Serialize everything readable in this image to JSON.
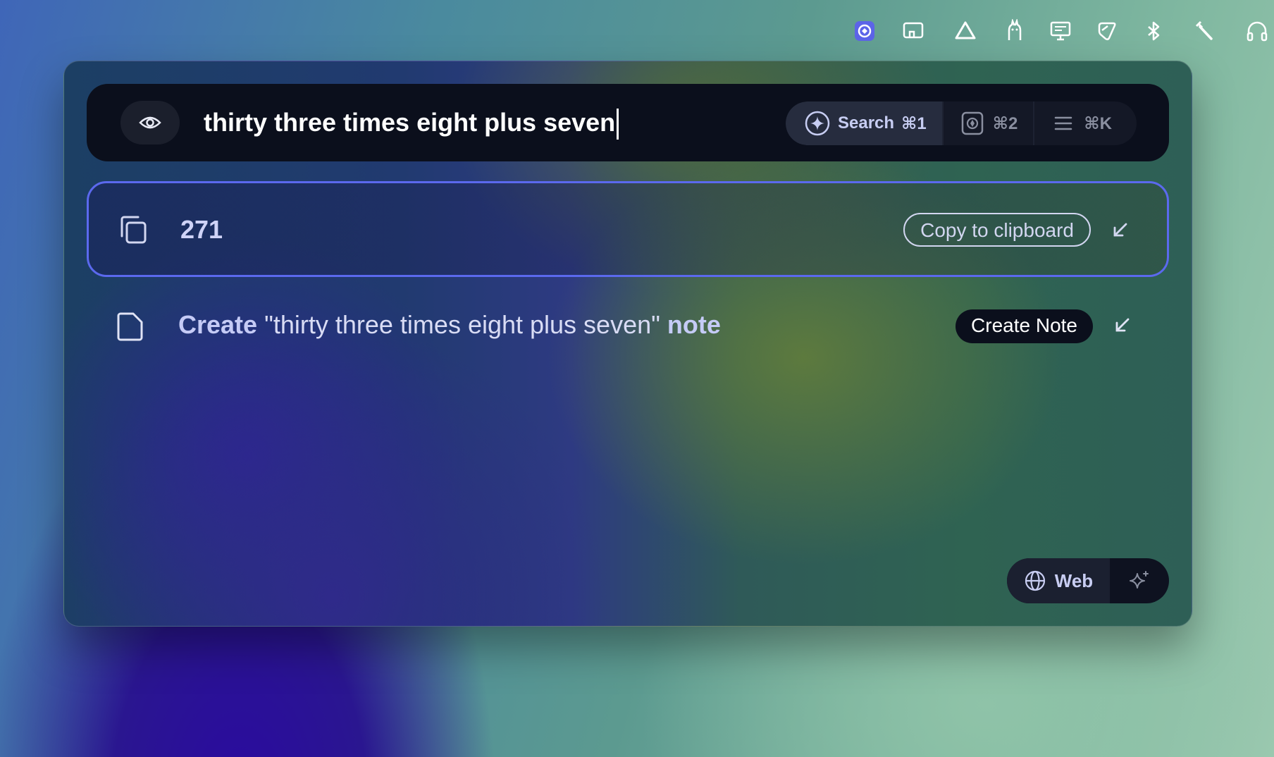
{
  "menubar": {
    "icons": [
      "app-launcher-icon",
      "screen-mirror-icon",
      "drive-icon",
      "llama-icon",
      "display-icon",
      "utility-icon",
      "bluetooth-icon",
      "tools-icon",
      "headphones-icon"
    ]
  },
  "search": {
    "query": "thirty three times eight plus seven",
    "modes": [
      {
        "label": "Search",
        "shortcut": "⌘1"
      },
      {
        "label": "",
        "shortcut": "⌘2"
      },
      {
        "label": "",
        "shortcut": "⌘K"
      }
    ]
  },
  "results": [
    {
      "text": "271",
      "action": "Copy to clipboard"
    },
    {
      "prefix": "Create",
      "middle": "\"thirty three times eight plus seven\"",
      "suffix": "note",
      "action": "Create Note"
    }
  ],
  "footer": {
    "web_label": "Web"
  },
  "colors": {
    "accent": "#5b69ee",
    "bar": "#0b0f1c"
  }
}
